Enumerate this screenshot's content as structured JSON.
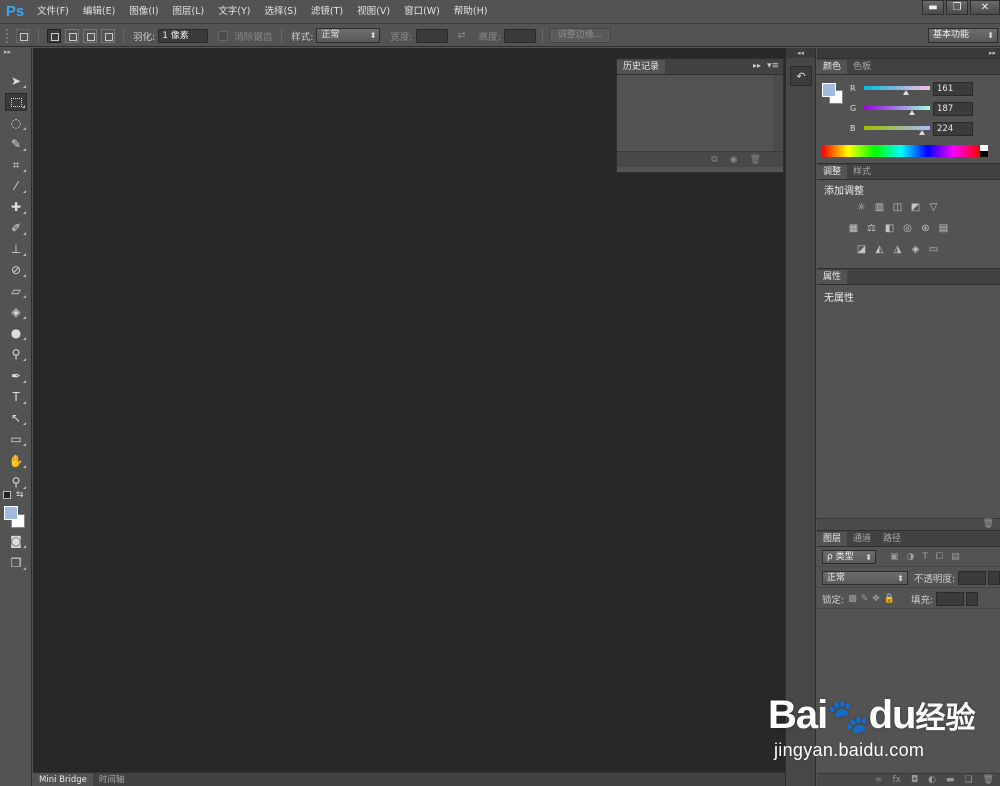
{
  "app": {
    "logo": "Ps"
  },
  "menu": {
    "items": [
      {
        "label": "文件(F)"
      },
      {
        "label": "编辑(E)"
      },
      {
        "label": "图像(I)"
      },
      {
        "label": "图层(L)"
      },
      {
        "label": "文字(Y)"
      },
      {
        "label": "选择(S)"
      },
      {
        "label": "滤镜(T)"
      },
      {
        "label": "视图(V)"
      },
      {
        "label": "窗口(W)"
      },
      {
        "label": "帮助(H)"
      }
    ]
  },
  "window_controls": {
    "minimize": "▬",
    "restore": "❐",
    "close": "✕"
  },
  "options": {
    "feather_label": "羽化:",
    "feather_value": "1 像素",
    "antialias_label": "消除锯齿",
    "style_label": "样式:",
    "style_value": "正常",
    "width_label": "宽度:",
    "height_label": "高度:",
    "refine_edge_label": "调整边缘...",
    "workspace_value": "基本功能"
  },
  "history_panel": {
    "tab": "历史记录"
  },
  "color_panel": {
    "tabs": [
      "颜色",
      "色板"
    ],
    "channels": [
      {
        "name": "R",
        "value": "161"
      },
      {
        "name": "G",
        "value": "187"
      },
      {
        "name": "B",
        "value": "224"
      }
    ],
    "levels": [
      0.63,
      0.73,
      0.88
    ],
    "foreground_color": "#a1bbe0",
    "background_color": "#ffffff"
  },
  "adjust_panel": {
    "tabs": [
      "调整",
      "样式"
    ],
    "title": "添加调整"
  },
  "props_panel": {
    "tab": "属性",
    "text": "无属性"
  },
  "layers_panel": {
    "tabs": [
      "图层",
      "通道",
      "路径"
    ],
    "filter_value": "ρ 类型",
    "blend_value": "正常",
    "opacity_label": "不透明度:",
    "lock_label": "锁定:",
    "fill_label": "填充:"
  },
  "bottom_tabs": [
    "Mini Bridge",
    "时间轴"
  ],
  "watermark": {
    "logo_left": "Bai",
    "logo_right": "du",
    "logo_cn": "经验",
    "url": "jingyan.baidu.com"
  }
}
